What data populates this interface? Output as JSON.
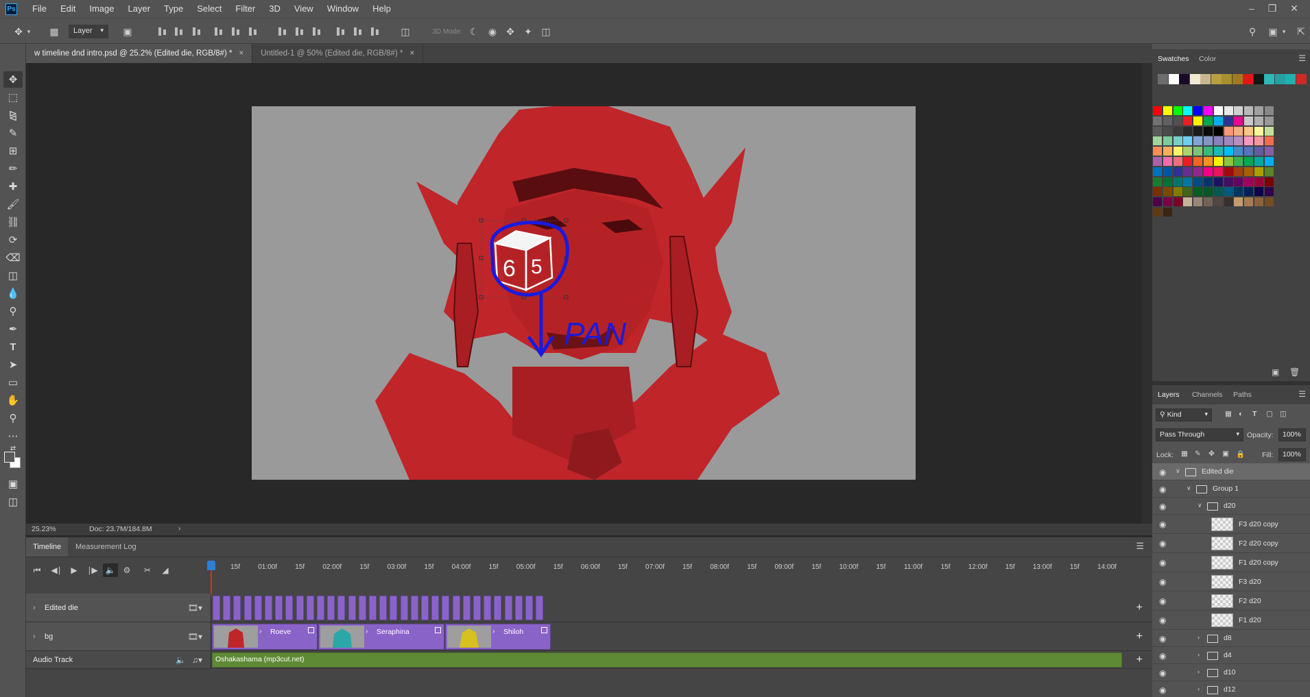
{
  "menu": [
    "File",
    "Edit",
    "Image",
    "Layer",
    "Type",
    "Select",
    "Filter",
    "3D",
    "View",
    "Window",
    "Help"
  ],
  "app_logo": "Ps",
  "options_bar": {
    "auto_select_target": "Layer",
    "mode_3d_label": "3D Mode:"
  },
  "doc_tabs": [
    {
      "label": "w timeline dnd intro.psd @ 25.2% (Edited die, RGB/8#) *",
      "active": true
    },
    {
      "label": "Untitled-1 @ 50% (Edited die, RGB/8#) *",
      "active": false
    }
  ],
  "canvas": {
    "annotation_text": "PAN",
    "die_numbers": [
      "6",
      "5"
    ]
  },
  "status": {
    "zoom": "25.23%",
    "doc": "Doc: 23.7M/184.8M"
  },
  "timeline": {
    "tabs": [
      "Timeline",
      "Measurement Log"
    ],
    "ruler": [
      "15f",
      "01:00f",
      "15f",
      "02:00f",
      "15f",
      "03:00f",
      "15f",
      "04:00f",
      "15f",
      "05:00f",
      "15f",
      "06:00f",
      "15f",
      "07:00f",
      "15f",
      "08:00f",
      "15f",
      "09:00f",
      "15f",
      "10:00f",
      "15f",
      "11:00f",
      "15f",
      "12:00f",
      "15f",
      "13:00f",
      "15f",
      "14:00f"
    ],
    "tracks": [
      {
        "name": "Edited die"
      },
      {
        "name": "bg",
        "clips": [
          {
            "name": "Roeve",
            "color": "#c0252a"
          },
          {
            "name": "Seraphina",
            "color": "#2aa8a8"
          },
          {
            "name": "Shiloh",
            "color": "#d8c020"
          }
        ]
      },
      {
        "name": "Audio Track",
        "audio_clip": "Oshakashama (mp3cut.net)"
      }
    ]
  },
  "swatches_panel": {
    "tabs": [
      "Swatches",
      "Color"
    ]
  },
  "layers_panel": {
    "tabs": [
      "Layers",
      "Channels",
      "Paths"
    ],
    "filter": "Kind",
    "blend_mode": "Pass Through",
    "opacity_label": "Opacity:",
    "opacity": "100%",
    "lock_label": "Lock:",
    "fill_label": "Fill:",
    "fill": "100%",
    "layers": [
      {
        "name": "Edited die",
        "type": "group",
        "indent": 0,
        "open": true,
        "selected": true
      },
      {
        "name": "Group 1",
        "type": "group",
        "indent": 1,
        "open": true
      },
      {
        "name": "d20",
        "type": "group",
        "indent": 2,
        "open": true
      },
      {
        "name": "F3 d20 copy",
        "type": "layer",
        "indent": 3
      },
      {
        "name": "F2 d20 copy",
        "type": "layer",
        "indent": 3
      },
      {
        "name": "F1 d20 copy",
        "type": "layer",
        "indent": 3
      },
      {
        "name": "F3 d20",
        "type": "layer",
        "indent": 3
      },
      {
        "name": "F2 d20",
        "type": "layer",
        "indent": 3
      },
      {
        "name": "F1 d20",
        "type": "layer",
        "indent": 3
      },
      {
        "name": "d8",
        "type": "group",
        "indent": 2,
        "open": false
      },
      {
        "name": "d4",
        "type": "group",
        "indent": 2,
        "open": false
      },
      {
        "name": "d10",
        "type": "group",
        "indent": 2,
        "open": false
      },
      {
        "name": "d12",
        "type": "group",
        "indent": 2,
        "open": false
      }
    ]
  },
  "colors": {
    "canvas_bg": "#9a9a9a",
    "character_red": "#c0252a",
    "annotation_blue": "#1a1adc",
    "clip_purple": "#8a63c8",
    "audio_green": "#5f8a35"
  }
}
